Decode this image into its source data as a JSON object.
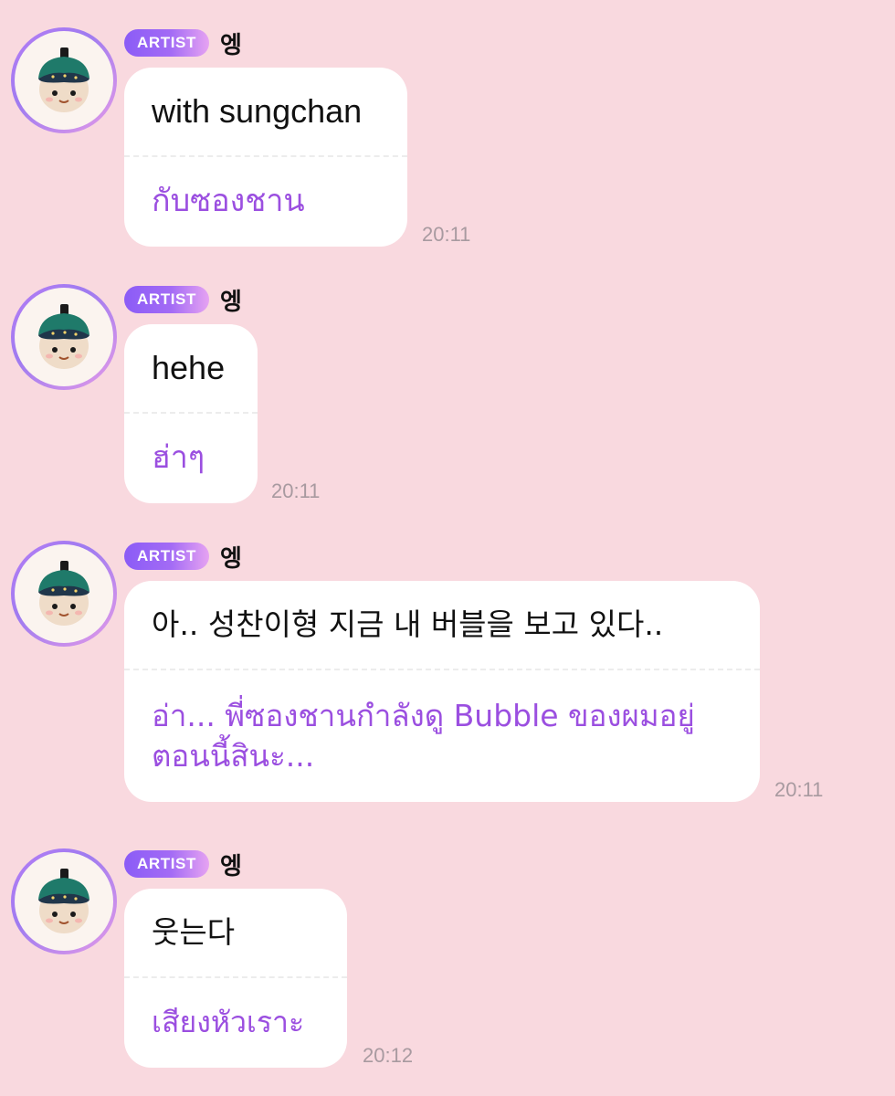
{
  "colors": {
    "background": "#f9d9df",
    "bubble": "#ffffff",
    "translation_text": "#9b4fe0",
    "badge_gradient_start": "#8b5cf6",
    "badge_gradient_end": "#e6a3f2",
    "timestamp": "#a89aa0"
  },
  "messages": [
    {
      "badge": "ARTIST",
      "sender": "엥",
      "avatar_icon": "plush-doll-avatar-icon",
      "text": "with sungchan",
      "translation": "กับซองชาน",
      "time": "20:11"
    },
    {
      "badge": "ARTIST",
      "sender": "엥",
      "avatar_icon": "plush-doll-avatar-icon",
      "text": "hehe",
      "translation": "ฮ่าๆ",
      "time": "20:11"
    },
    {
      "badge": "ARTIST",
      "sender": "엥",
      "avatar_icon": "plush-doll-avatar-icon",
      "text": "아.. 성찬이형 지금 내 버블을 보고 있다..",
      "translation": "อ่า... พี่ซองชานกำลังดู Bubble ของผมอยู่ตอนนี้สินะ...",
      "time": "20:11"
    },
    {
      "badge": "ARTIST",
      "sender": "엥",
      "avatar_icon": "plush-doll-avatar-icon",
      "text": "웃는다",
      "translation": "เสียงหัวเราะ",
      "time": "20:12"
    }
  ]
}
